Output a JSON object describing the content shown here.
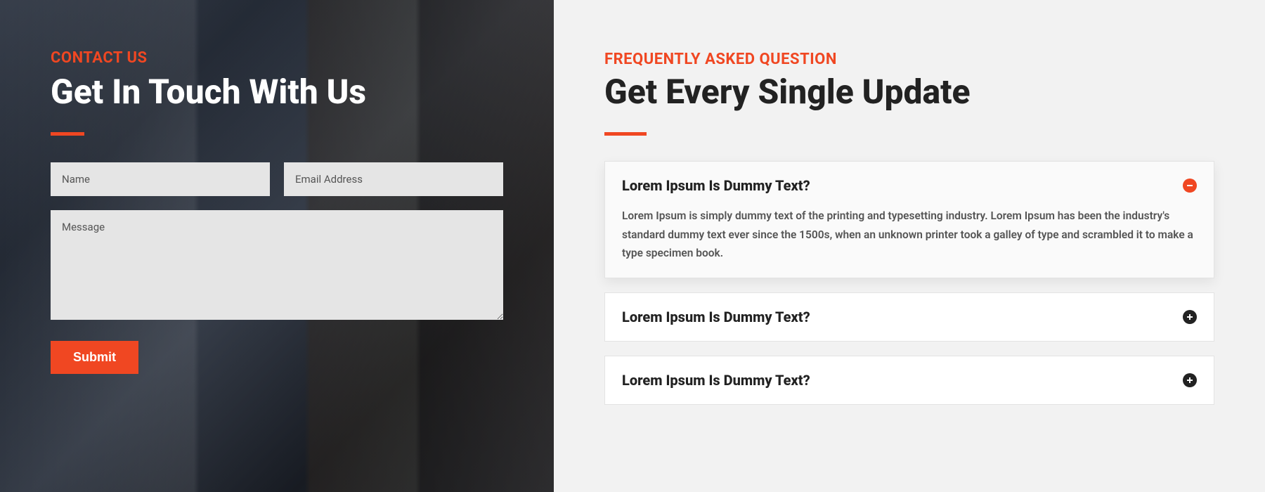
{
  "contact": {
    "eyebrow": "CONTACT US",
    "heading": "Get In Touch With Us",
    "name_placeholder": "Name",
    "email_placeholder": "Email Address",
    "message_placeholder": "Message",
    "submit_label": "Submit"
  },
  "faq": {
    "eyebrow": "FREQUENTLY ASKED QUESTION",
    "heading": "Get Every Single Update",
    "items": [
      {
        "question": "Lorem Ipsum Is Dummy Text?",
        "answer": "Lorem Ipsum is simply dummy text of the printing and typesetting industry. Lorem Ipsum has been the industry's standard dummy text ever since the 1500s, when an unknown printer took a galley of type and scrambled it to make a type specimen book.",
        "open": true
      },
      {
        "question": "Lorem Ipsum Is Dummy Text?",
        "open": false
      },
      {
        "question": "Lorem Ipsum Is Dummy Text?",
        "open": false
      }
    ]
  },
  "colors": {
    "accent": "#f04722"
  }
}
